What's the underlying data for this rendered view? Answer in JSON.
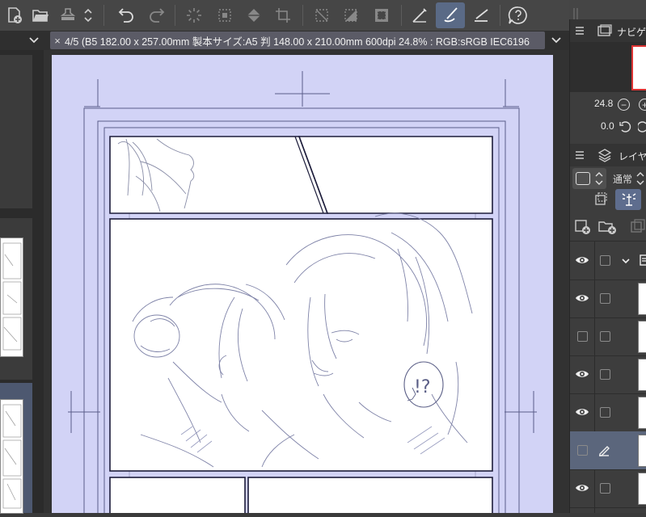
{
  "toolbar": {
    "icons": [
      "new-page-icon",
      "open-folder-icon",
      "stamp-icon",
      "spin-icon",
      "undo-icon",
      "redo-icon",
      "loading-icon",
      "transform-icon",
      "fill-icon",
      "crop-icon",
      "clear-selection-icon",
      "fill-selection-icon",
      "invert-selection-icon",
      "ruler-icon",
      "brush-icon",
      "line-icon",
      "help-icon"
    ],
    "active": "brush-icon"
  },
  "document_tab": {
    "close": "×",
    "title": "4/5 (B5 182.00 x 257.00mm 製本サイズ:A5 判 148.00 x 210.00mm 600dpi 24.8% : RGB:sRGB IEC6196"
  },
  "navigator": {
    "title": "ナビゲ",
    "zoom": "24.8",
    "rotation": "0.0"
  },
  "layers": {
    "title": "レイヤ",
    "blend_mode": "通常",
    "rows": [
      {
        "visible": true,
        "selected": false,
        "folder": true
      },
      {
        "visible": true,
        "selected": false
      },
      {
        "visible": false,
        "selected": false
      },
      {
        "visible": true,
        "selected": false
      },
      {
        "visible": true,
        "selected": false
      },
      {
        "visible": false,
        "selected": true
      },
      {
        "visible": true,
        "selected": false
      }
    ]
  },
  "colors": {
    "paper": "#d2d3f6",
    "accent": "#5b667c",
    "panel": "#3d3d3d"
  }
}
